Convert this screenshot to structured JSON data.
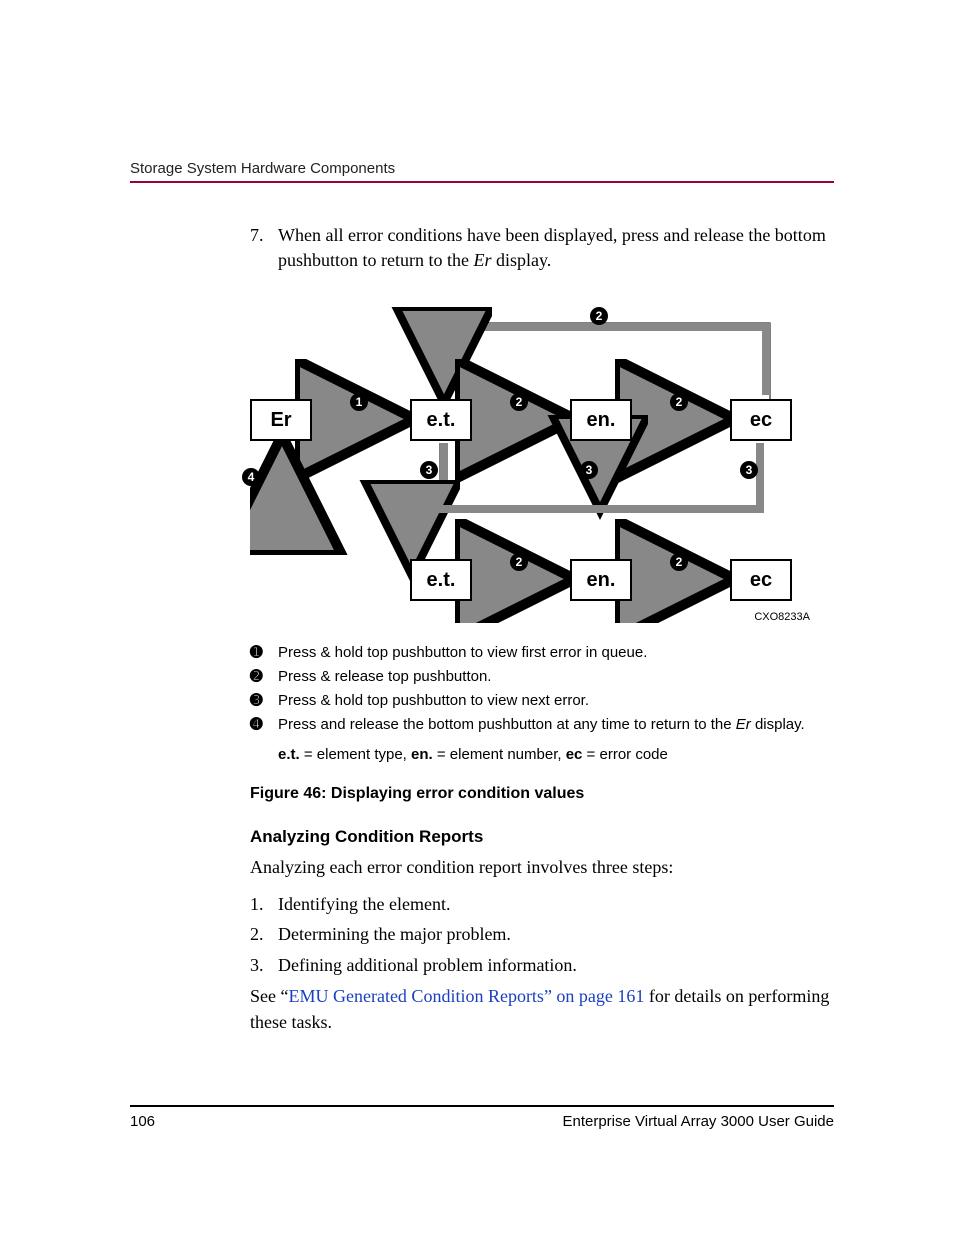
{
  "header": {
    "section": "Storage System Hardware Components"
  },
  "step7": {
    "number": "7.",
    "text_a": "When all error conditions have been displayed, press and release the bottom pushbutton to return to the ",
    "text_b": "Er",
    "text_c": " display."
  },
  "diagram": {
    "boxes": {
      "er": "Er",
      "et1": "e.t.",
      "en1": "en.",
      "ec1": "ec",
      "et2": "e.t.",
      "en2": "en.",
      "ec2": "ec"
    },
    "badges": {
      "b1": "1",
      "b2a": "2",
      "b2b": "2",
      "b2c": "2",
      "b2d": "2",
      "b2e": "2",
      "b2f": "2",
      "b3a": "3",
      "b3b": "3",
      "b3c": "3",
      "b4": "4"
    },
    "id": "CXO8233A"
  },
  "legend": {
    "items": [
      {
        "mark": "➊",
        "text": "Press & hold top pushbutton to view first error in queue."
      },
      {
        "mark": "➋",
        "text": "Press & release top pushbutton."
      },
      {
        "mark": "➌",
        "text": "Press & hold top pushbutton to view next error."
      },
      {
        "mark": "➍",
        "text_a": "Press and release the bottom pushbutton at any time to return to the ",
        "text_b": "Er",
        "text_c": " display."
      }
    ],
    "defs": {
      "et_k": "e.t.",
      "et_v": " = element type, ",
      "en_k": "en.",
      "en_v": " = element number, ",
      "ec_k": "ec",
      "ec_v": " = error code"
    }
  },
  "figcap": "Figure 46:  Displaying error condition values",
  "analyzing": {
    "heading": "Analyzing Condition Reports",
    "intro": "Analyzing each error condition report involves three steps:",
    "items": [
      {
        "n": "1.",
        "t": "Identifying the element."
      },
      {
        "n": "2.",
        "t": "Determining the major problem."
      },
      {
        "n": "3.",
        "t": "Defining additional problem information."
      }
    ],
    "see_a": "See “",
    "see_link": "EMU Generated Condition Reports” on page 161",
    "see_b": " for details on performing these tasks."
  },
  "footer": {
    "page": "106",
    "title": "Enterprise Virtual Array 3000 User Guide"
  }
}
